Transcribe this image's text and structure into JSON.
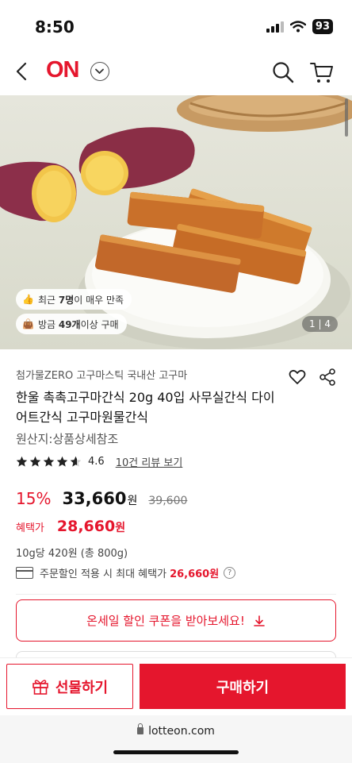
{
  "status_bar": {
    "time": "8:50",
    "battery": "93"
  },
  "header": {
    "logo": "ON"
  },
  "hero": {
    "badges": [
      {
        "prefix": "최근 ",
        "bold": "7명",
        "suffix": "이 매우 만족"
      },
      {
        "prefix": "방금 ",
        "bold": "49개",
        "suffix": "이상 구매"
      }
    ],
    "page_indicator": "1 | 4"
  },
  "product": {
    "brand_line": "첨가물ZERO 고구마스틱 국내산 고구마",
    "title": "한울 촉촉고구마간식 20g 40입 사무실간식 다이어트간식 고구마원물간식",
    "origin": "원산지:상품상세참조",
    "rating": 4.6,
    "rating_text": "4.6",
    "review_link": "10건 리뷰 보기",
    "discount": "15%",
    "price": "33,660",
    "currency": "원",
    "original_price": "39,600",
    "benefit_label": "혜택가",
    "benefit_price": "28,660",
    "unit_price": "10g당 420원 (총 800g)",
    "card_text": "주문할인 적용 시 최대 혜택가",
    "card_max": "26,660원",
    "help": "?"
  },
  "coupon": {
    "label": "온세일 할인 쿠폰을 받아보세요!"
  },
  "bottom_bar": {
    "gift_label": "선물하기",
    "buy_label": "구매하기"
  },
  "browser": {
    "url": "lotteon.com"
  },
  "colors": {
    "brand": "#e5162d"
  },
  "icons": [
    "back-icon",
    "chevron-down-icon",
    "search-icon",
    "cart-icon",
    "heart-icon",
    "share-icon",
    "star-icon",
    "card-icon",
    "help-icon",
    "download-icon",
    "gift-icon",
    "lock-icon"
  ]
}
